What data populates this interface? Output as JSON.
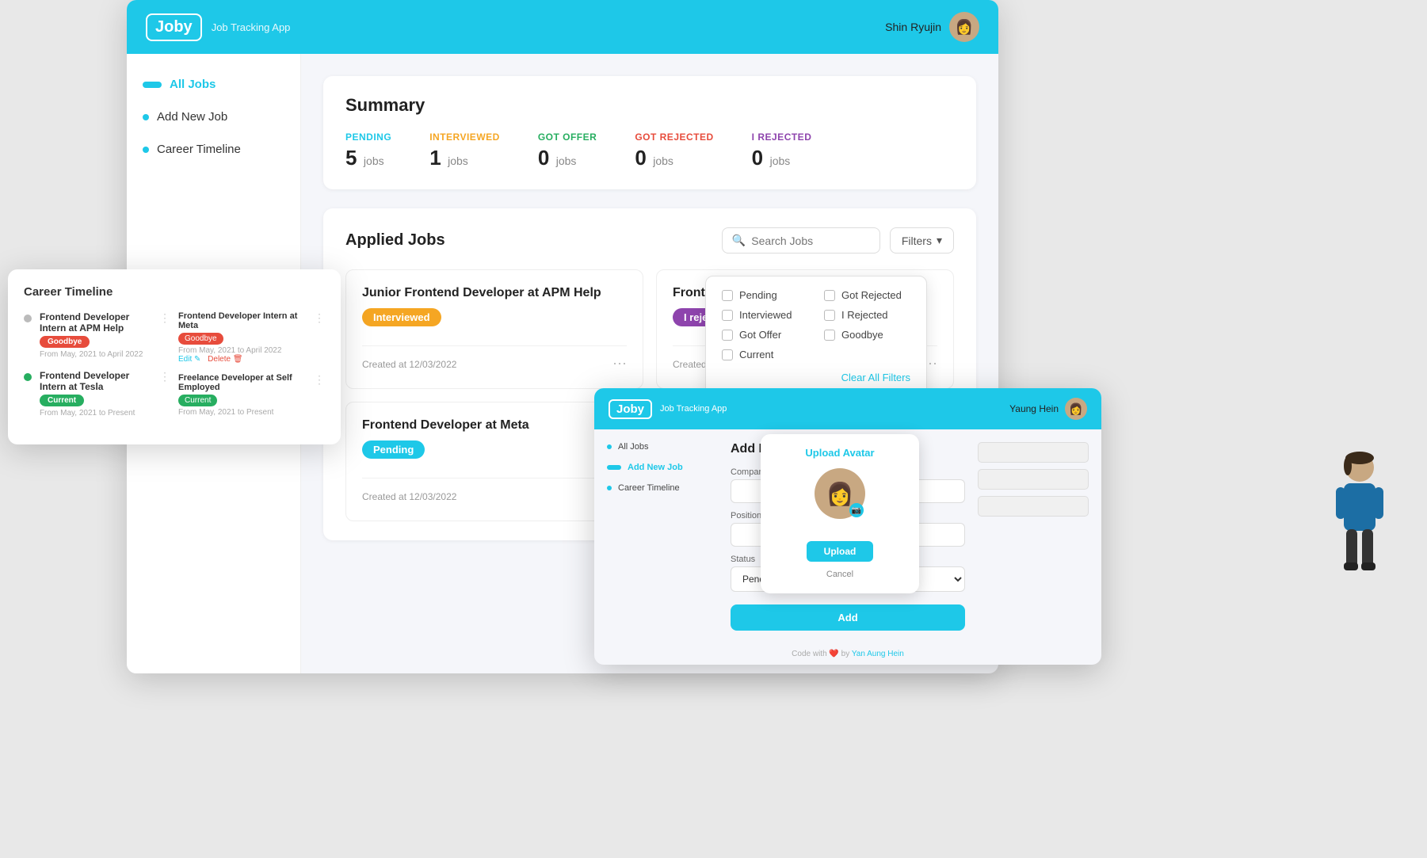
{
  "app": {
    "name": "Joby",
    "subtitle": "Job Tracking App",
    "user": {
      "name": "Shin Ryujin",
      "avatar": "👩"
    }
  },
  "sidebar": {
    "items": [
      {
        "label": "All Jobs",
        "active": true
      },
      {
        "label": "Add New Job",
        "active": false
      },
      {
        "label": "Career Timeline",
        "active": false
      }
    ]
  },
  "summary": {
    "title": "Summary",
    "stats": [
      {
        "label": "PENDING",
        "value": "5",
        "unit": "jobs"
      },
      {
        "label": "INTERVIEWED",
        "value": "1",
        "unit": "jobs"
      },
      {
        "label": "GOT OFFER",
        "value": "0",
        "unit": "jobs"
      },
      {
        "label": "GOT REJECTED",
        "value": "0",
        "unit": "jobs"
      },
      {
        "label": "I REJECTED",
        "value": "0",
        "unit": "jobs"
      }
    ]
  },
  "applied_jobs": {
    "title": "Applied Jobs",
    "search_placeholder": "Search Jobs",
    "filters_label": "Filters",
    "jobs": [
      {
        "title": "Junior Frontend Developer at APM Help",
        "badge": "Interviewed",
        "badge_type": "interviewed",
        "date": "Created at 12/03/2022"
      },
      {
        "title": "Frontend Developer at Tesla",
        "badge": "I rejected",
        "badge_type": "i-rejected",
        "date": "Created at 12/03/2022"
      },
      {
        "title": "Frontend Developer at Meta",
        "badge": "Pending",
        "badge_type": "pending",
        "date": "Created at 12/03/2022"
      }
    ],
    "filters": {
      "items": [
        "Pending",
        "Got Rejected",
        "Interviewed",
        "I Rejected",
        "Got Offer",
        "Goodbye",
        "Current",
        ""
      ],
      "clear_label": "Clear All Filters"
    }
  },
  "career_timeline": {
    "title": "Career Timeline",
    "items": [
      {
        "job_title": "Frontend Developer Intern at APM Help",
        "badge": "Goodbye",
        "badge_type": "goodbye",
        "date": "From May, 2021 to April 2022"
      },
      {
        "job_title": "Frontend Developer Intern at Tesla",
        "badge": "Current",
        "badge_type": "current",
        "date": "From May, 2021 to Present"
      }
    ],
    "right_items": [
      {
        "job_title": "Frontend Developer Intern at Meta",
        "badge": "Goodbye",
        "badge_type": "goodbye",
        "date": "From May, 2021 to April 2022"
      },
      {
        "job_title": "Freelance Developer at Self Employed",
        "badge": "Current",
        "badge_type": "current",
        "date": "From May, 2021 to Present"
      }
    ]
  },
  "add_job": {
    "app_name": "Joby",
    "subtitle": "Job Tracking App",
    "user_name": "Yaung Hein",
    "title": "Add New Job",
    "sidebar_items": [
      "All Jobs",
      "Add New Job",
      "Career Timeline"
    ],
    "fields": {
      "company_label": "Company",
      "position_label": "Position",
      "status_label": "Status",
      "status_value": "Pending"
    },
    "add_button": "Add",
    "footer_text": "Code with",
    "footer_by": "by",
    "footer_author": "Yan Aung Hein"
  },
  "upload_modal": {
    "title": "Upload Avatar",
    "upload_label": "Upload",
    "cancel_label": "Cancel"
  },
  "icons": {
    "search": "🔍",
    "chevron_down": "▾",
    "dots": "⋯",
    "camera": "📷"
  }
}
